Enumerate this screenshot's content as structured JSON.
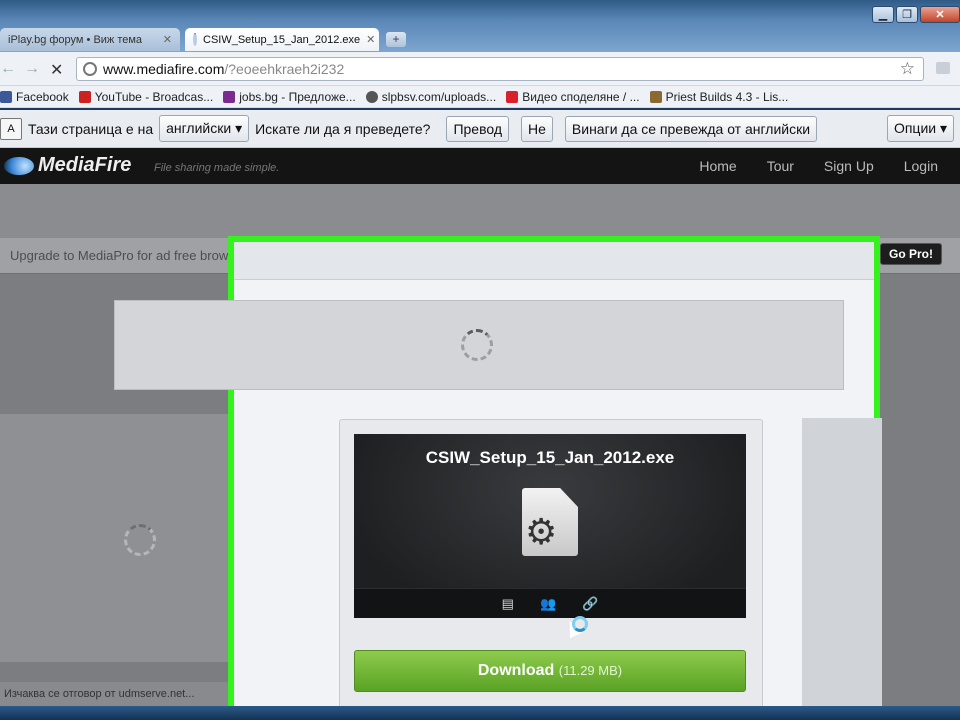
{
  "window": {
    "minimize": "▁",
    "maximize": "❐",
    "close": "✕"
  },
  "tabs": [
    {
      "label": "iPlay.bg форум • Виж тема",
      "close": "✕"
    },
    {
      "label": "CSIW_Setup_15_Jan_2012.exe",
      "close": "✕"
    }
  ],
  "new_tab": "+",
  "toolbar": {
    "back": "←",
    "forward": "→",
    "stop": "✕",
    "url_host": "www.mediafire.com",
    "url_path": "/?eoeehkraeh2i232",
    "star": "☆"
  },
  "bookmarks": [
    {
      "label": "Facebook",
      "color": "#3b5998"
    },
    {
      "label": "YouTube - Broadcas...",
      "color": "#cc2222"
    },
    {
      "label": "jobs.bg - Предложе...",
      "color": "#7b2a8f"
    },
    {
      "label": "slpbsv.com/uploads...",
      "color": "#555555"
    },
    {
      "label": "Видео споделяне / ...",
      "color": "#d8212a"
    },
    {
      "label": "Priest Builds 4.3 - Lis...",
      "color": "#8a6a30"
    }
  ],
  "translate_bar": {
    "icon_text": "A",
    "prefix": "Тази страница е на",
    "language": "английски ▾",
    "question": "Искате ли да я преведете?",
    "translate_btn": "Превод",
    "no_btn": "Не",
    "always_btn": "Винаги да се превежда от английски",
    "options_btn": "Опции ▾"
  },
  "site": {
    "logo": "MediaFire",
    "tagline": "File sharing made simple.",
    "nav": [
      "Home",
      "Tour",
      "Sign Up",
      "Login"
    ],
    "promo_text": "Upgrade to MediaPro for ad free browsing, direct linking, and more.",
    "go_pro": "Go Pro!"
  },
  "file": {
    "name": "CSIW_Setup_15_Jan_2012.exe",
    "gear": "⚙",
    "bar_icons": [
      "▤",
      "👥",
      "🔗"
    ],
    "download_label": "Download",
    "download_size": "(11.29 MB)"
  },
  "status": "Изчаква се отговор от udmserve.net...",
  "colors": {
    "highlight": "#35f21f",
    "download_green": "#6cb332"
  }
}
